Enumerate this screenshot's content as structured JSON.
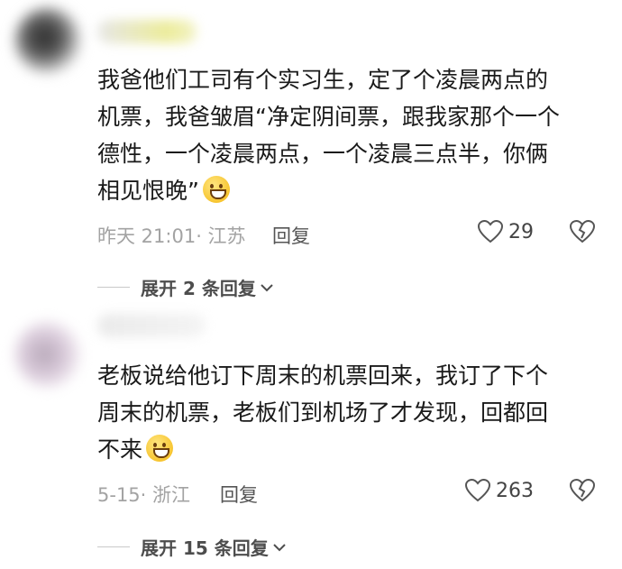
{
  "comments": [
    {
      "text_lines": [
        "我爸他们工司有个实习生，定了个凌晨两点的",
        "机票，我爸皱眉“净定阴间票，跟我家那个一个",
        "德性，一个凌晨两点，一个凌晨三点半，你俩",
        "相见恨晚”"
      ],
      "emoji": "grinning-sweat-emoji",
      "meta": "昨天 21:01· 江苏",
      "reply_label": "回复",
      "likes": "29",
      "expand_label": "展开 2 条回复"
    },
    {
      "text_lines": [
        "老板说给他订下周末的机票回来，我订了下个",
        "周末的机票，老板们到机场了才发现，回都回",
        "不来"
      ],
      "emoji": "goofy-face-emoji",
      "meta": "5-15· 浙江",
      "reply_label": "回复",
      "likes": "263",
      "expand_label": "展开 15 条回复"
    }
  ],
  "icons": {
    "like": "heart-outline-icon",
    "dislike": "broken-heart-icon",
    "expand": "chevron-down-icon"
  },
  "colors": {
    "text": "#1a1a1a",
    "meta": "#a3a3a3",
    "icon": "#555555"
  }
}
